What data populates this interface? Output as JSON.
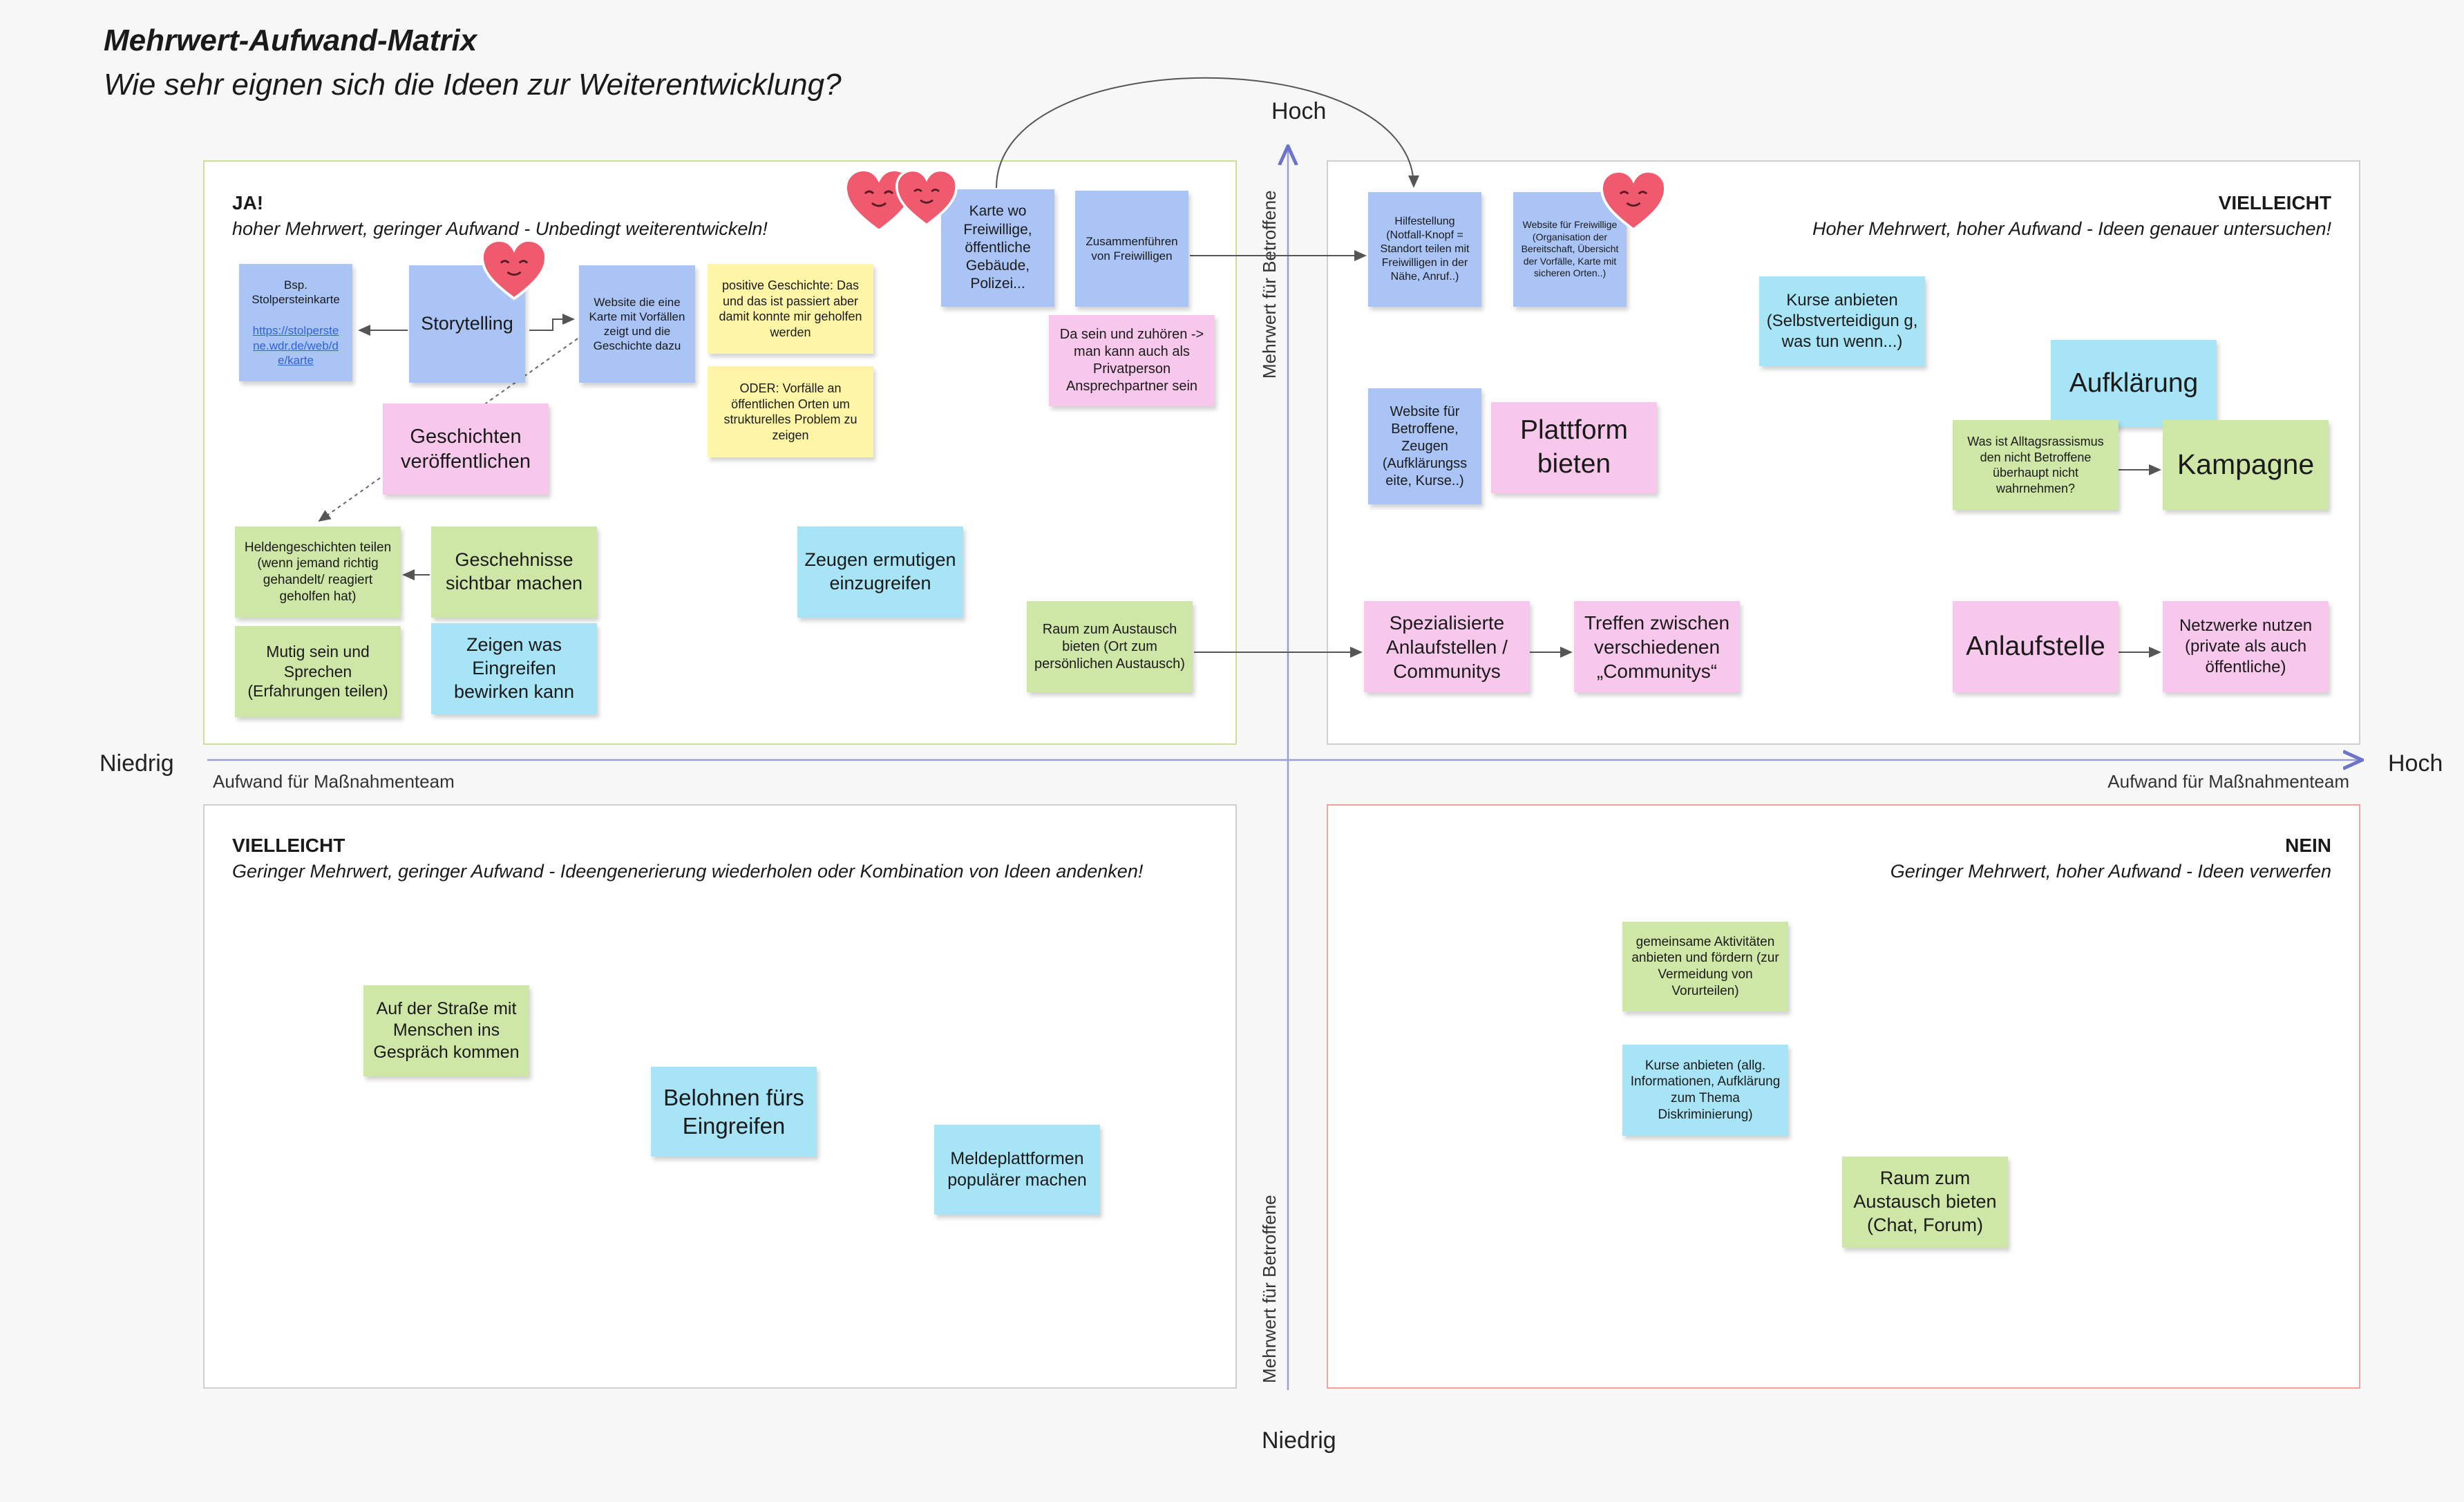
{
  "title": "Mehrwert-Aufwand-Matrix",
  "subtitle": "Wie sehr eignen sich die Ideen zur Weiterentwicklung?",
  "axes": {
    "y_top": "Hoch",
    "y_bottom": "Niedrig",
    "x_left": "Niedrig",
    "x_right": "Hoch",
    "x_label": "Aufwand für Maßnahmenteam",
    "y_label": "Mehrwert für Betroffene"
  },
  "quadrants": {
    "ja": {
      "head": "JA!",
      "desc": "hoher Mehrwert, geringer Aufwand - Unbedingt weiterentwickeln!"
    },
    "vielleicht_top": {
      "head": "VIELLEICHT",
      "desc": "Hoher Mehrwert, hoher Aufwand - Ideen genauer untersuchen!"
    },
    "vielleicht_bottom": {
      "head": "VIELLEICHT",
      "desc": "Geringer Mehrwert, geringer Aufwand - Ideengenerierung wiederholen oder Kombination von Ideen andenken!"
    },
    "nein": {
      "head": "NEIN",
      "desc": "Geringer Mehrwert, hoher Aufwand - Ideen verwerfen"
    }
  },
  "notes": {
    "bsp_stolperstein": {
      "text": "Bsp.\nStolpersteinkarte",
      "link": "https://stolperste\nne.wdr.de/web/d\ne/karte"
    },
    "storytelling": "Storytelling",
    "website_karte": "Website die eine Karte mit Vorfällen zeigt und die Geschichte dazu",
    "positive_geschichte": "positive Geschichte: Das und das ist passiert aber damit konnte mir geholfen werden",
    "oder_vorfaelle": "ODER: Vorfälle an öffentlichen Orten um strukturelles Problem zu zeigen",
    "geschichten_veroeffentlichen": "Geschichten veröffentlichen",
    "heldengeschichten": "Heldengeschichten teilen (wenn jemand richtig gehandelt/ reagiert geholfen hat)",
    "geschehnisse": "Geschehnisse sichtbar machen",
    "mutig_sein": "Mutig sein und Sprechen (Erfahrungen teilen)",
    "zeigen_eingreifen": "Zeigen was Eingreifen bewirken kann",
    "zeugen_ermutigen": "Zeugen ermutigen einzugreifen",
    "karte_freiwillige": "Karte wo Freiwillige, öffentliche Gebäude, Polizei...",
    "zusammenfuehren": "Zusammenführen von Freiwilligen",
    "da_sein": "Da sein und zuhören -> man kann auch als Privatperson Ansprechpartner sein",
    "raum_austausch_ort": "Raum zum Austausch bieten (Ort zum persönlichen Austausch)",
    "hilfestellung": "Hilfestellung (Notfall-Knopf = Standort teilen mit Freiwilligen in der Nähe, Anruf..)",
    "website_freiwillige": "Website für Freiwillige (Organisation der Bereitschaft, Übersicht der Vorfälle, Karte mit sicheren Orten..)",
    "kurse_selbstverteidigung": "Kurse anbieten (Selbstverteidigun g, was tun wenn...)",
    "website_betroffene": "Website für Betroffene, Zeugen (Aufklärungss eite, Kurse..)",
    "plattform_bieten": "Plattform bieten",
    "aufklaerung": "Aufklärung",
    "alltagsrassismus": "Was ist Alltagsrassismus den nicht Betroffene überhaupt nicht wahrnehmen?",
    "kampagne": "Kampagne",
    "spezialisierte_anlaufstellen": "Spezialisierte Anlaufstellen / Communitys",
    "treffen_communitys": "Treffen zwischen verschiedenen „Communitys“",
    "anlaufstelle": "Anlaufstelle",
    "netzwerke_nutzen": "Netzwerke nutzen (private als auch öffentliche)",
    "auf_der_strasse": "Auf der Straße mit Menschen ins Gespräch kommen",
    "belohnen": "Belohnen fürs Eingreifen",
    "meldeplattformen": "Meldeplattformen populärer machen",
    "gemeinsame_aktivitaeten": "gemeinsame Aktivitäten anbieten und fördern (zur Vermeidung von Vorurteilen)",
    "kurse_allg": "Kurse anbieten (allg. Informationen, Aufklärung zum Thema Diskriminierung)",
    "raum_chat_forum": "Raum zum Austausch bieten (Chat, Forum)"
  },
  "colors": {
    "blue": "#a9c4f5",
    "cyan": "#a6e4f6",
    "pink": "#f8c8ec",
    "green": "#cfe7a6",
    "yellow": "#fff5a6",
    "heart": "#f05a6e",
    "frame_ja": "#c9df9b",
    "frame_nein": "#f0a39a"
  }
}
